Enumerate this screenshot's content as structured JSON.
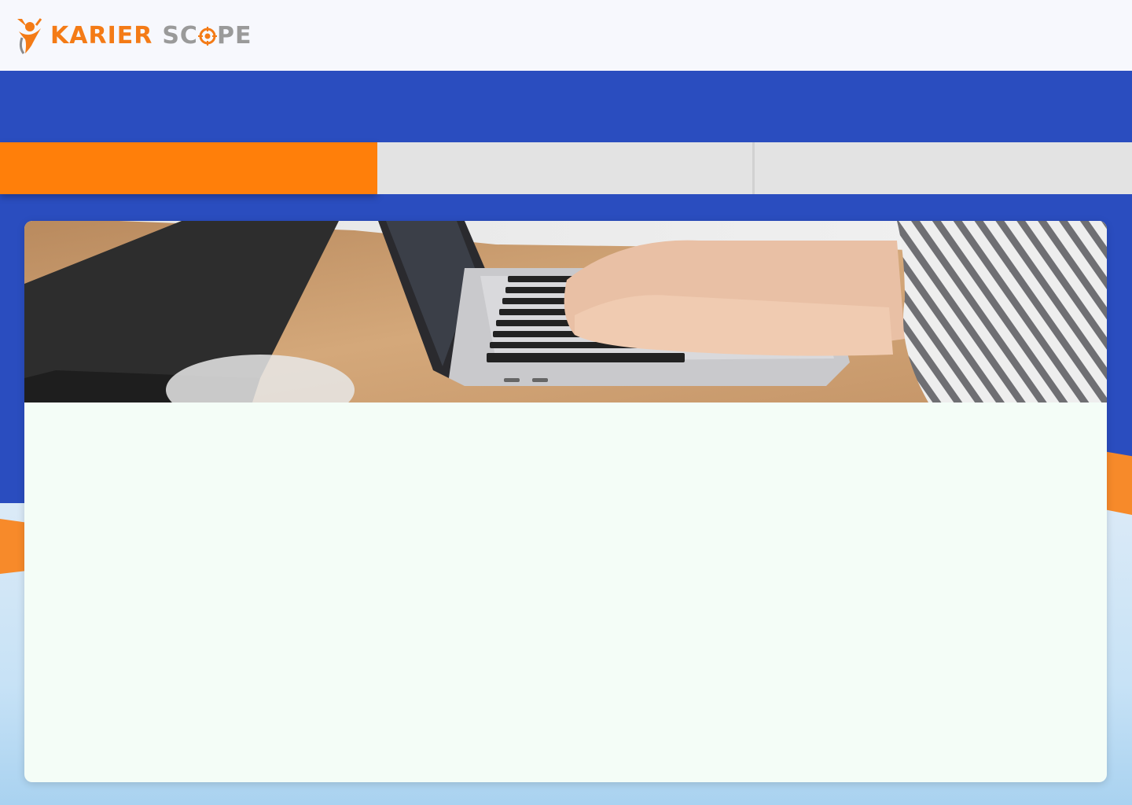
{
  "header": {
    "logo_icon": "person-target-logo-icon",
    "brand_part1": "KARIER",
    "brand_part2_pre": "SC",
    "brand_part2_post": "PE"
  },
  "tabs": [
    {
      "label": "",
      "active": true
    },
    {
      "label": "",
      "active": false
    },
    {
      "label": "",
      "active": false
    }
  ],
  "hero": {
    "icon": "laptop-typing-photo"
  },
  "colors": {
    "brand_orange": "#f47b16",
    "brand_gray": "#9a9a9a",
    "band_blue": "#2a4dbf",
    "active_tab": "#ff7f0a",
    "inactive_tab": "#e3e3e3",
    "card_bg": "#f4fdf7"
  }
}
